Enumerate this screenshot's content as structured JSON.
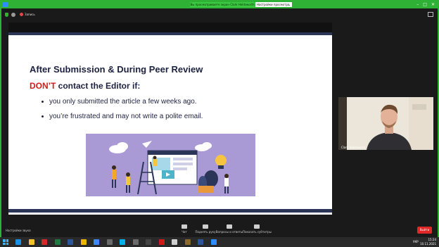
{
  "window": {
    "share_banner": "Вы просматриваете экран Clark Holdsworth",
    "view_options": "Настройки просмотра",
    "controls": [
      "–",
      "□",
      "✕"
    ]
  },
  "topbar": {
    "recording": "Запись"
  },
  "slide": {
    "title": "After Submission & During Peer Review",
    "sub_highlight": "DON’T",
    "sub_rest": " contact the Editor if:",
    "bullets": [
      "you only submitted the article a few weeks ago.",
      "you’re frustrated and may not write a polite email."
    ]
  },
  "video": {
    "participant_name": "Clark Holdsworth"
  },
  "toolbar": {
    "settings": "Настройки звука",
    "buttons": [
      {
        "label": "Чат",
        "icon": "chat-icon"
      },
      {
        "label": "Поднять руку",
        "icon": "hand-icon"
      },
      {
        "label": "Вопросы и ответы",
        "icon": "qa-icon"
      },
      {
        "label": "Показать субтитры",
        "icon": "cc-icon"
      }
    ],
    "leave": "Выйти"
  },
  "taskbar": {
    "apps": [
      {
        "icon": "edge-icon",
        "color": "#1f8fe0"
      },
      {
        "icon": "folder-icon",
        "color": "#f2c230"
      },
      {
        "icon": "pdf-icon",
        "color": "#d02b2b"
      },
      {
        "icon": "excel-icon",
        "color": "#1f7a3f"
      },
      {
        "icon": "word-doc-icon",
        "color": "#2b579a"
      },
      {
        "icon": "notes-icon",
        "color": "#f0b400"
      },
      {
        "icon": "chrome-icon",
        "color": "#4285f4"
      },
      {
        "icon": "app-icon",
        "color": "#6a6a6a"
      },
      {
        "icon": "skype-icon",
        "color": "#00aff0"
      },
      {
        "icon": "winamp-icon",
        "color": "#6b6b6b"
      },
      {
        "icon": "media-icon",
        "color": "#444444"
      },
      {
        "icon": "opera-icon",
        "color": "#cc1b1b"
      },
      {
        "icon": "app-icon",
        "color": "#d0d0d0"
      },
      {
        "icon": "utility-icon",
        "color": "#8a6a2a"
      },
      {
        "icon": "word-icon",
        "color": "#2b579a"
      },
      {
        "icon": "zoom-icon",
        "color": "#2d8cff"
      }
    ],
    "lang": "УКР",
    "time": "15:24",
    "date": "10.11.2021"
  }
}
